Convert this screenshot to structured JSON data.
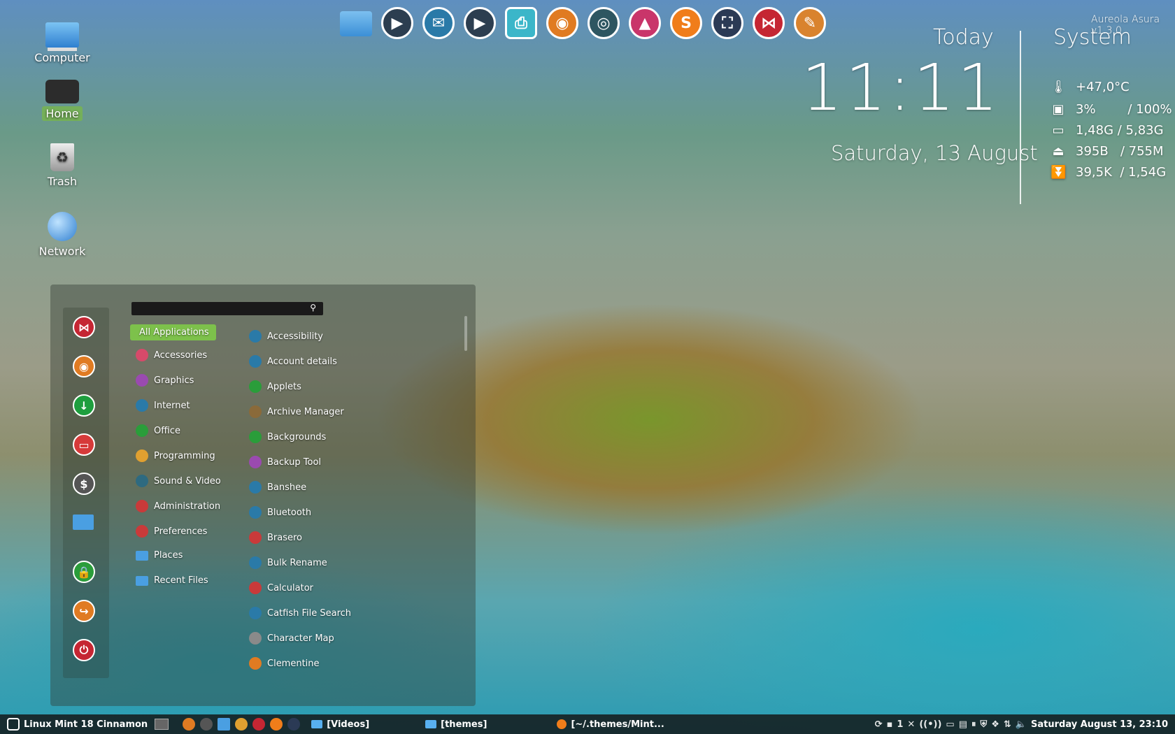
{
  "desktop": {
    "icons": [
      {
        "label": "Computer",
        "icon": "computer-icon"
      },
      {
        "label": "Home",
        "icon": "home-folder-icon"
      },
      {
        "label": "Trash",
        "icon": "trash-icon"
      },
      {
        "label": "Network",
        "icon": "network-icon"
      }
    ]
  },
  "dock": {
    "items": [
      {
        "icon": "folder-icon",
        "color": "#4a9fe2"
      },
      {
        "icon": "video-player-icon",
        "color": "#2c3e50"
      },
      {
        "icon": "thunderbird-icon",
        "color": "#2a7aa8"
      },
      {
        "icon": "video-player-icon",
        "color": "#2c3e50"
      },
      {
        "icon": "printer-icon",
        "color": "#3bb6c9"
      },
      {
        "icon": "firefox-icon",
        "color": "#e07b22"
      },
      {
        "icon": "eye-of-gnome-icon",
        "color": "#2e5661"
      },
      {
        "icon": "inkscape-icon",
        "color": "#c9356a"
      },
      {
        "icon": "sublime-text-icon",
        "color": "#f07d1a"
      },
      {
        "icon": "screenshot-icon",
        "color": "#2b3a55"
      },
      {
        "icon": "bow-tie-app-icon",
        "color": "#c52633"
      },
      {
        "icon": "gimp-icon",
        "color": "#d9832e"
      }
    ]
  },
  "conky": {
    "version": "Aureola Asura v1.3.0",
    "today_title": "Today",
    "time": "11:11",
    "date": "Saturday, 13 August",
    "system_title": "System",
    "stats": [
      {
        "icon": "thermometer-icon",
        "text": "+47,0°C"
      },
      {
        "icon": "cpu-icon",
        "text": "3%        / 100%"
      },
      {
        "icon": "memory-icon",
        "text": "1,48G / 5,83G"
      },
      {
        "icon": "upload-icon",
        "text": "395B   / 755M"
      },
      {
        "icon": "download-icon",
        "text": "39,5K  / 1,54G"
      }
    ]
  },
  "menu": {
    "search_placeholder": "",
    "favorites": [
      {
        "icon": "bow-tie-app-icon",
        "color": "#c52633"
      },
      {
        "icon": "firefox-icon",
        "color": "#e07b22"
      },
      {
        "icon": "download-icon",
        "color": "#1e9e3e"
      },
      {
        "icon": "media-icon",
        "color": "#d63a3a"
      },
      {
        "icon": "terminal-icon",
        "color": "#555555"
      },
      {
        "icon": "folder-icon",
        "color": "#4a9fe2"
      },
      {
        "icon": "lock-icon",
        "color": "#2a9d3a"
      },
      {
        "icon": "logout-icon",
        "color": "#e07b22"
      },
      {
        "icon": "power-icon",
        "color": "#c52633"
      }
    ],
    "categories": [
      {
        "label": "All Applications",
        "color": "#7dc14b"
      },
      {
        "label": "Accessories",
        "color": "#d64a6a"
      },
      {
        "label": "Graphics",
        "color": "#9a4ab0"
      },
      {
        "label": "Internet",
        "color": "#2a7aa8"
      },
      {
        "label": "Office",
        "color": "#2a9d3a"
      },
      {
        "label": "Programming",
        "color": "#e0a030"
      },
      {
        "label": "Sound & Video",
        "color": "#2e6a80"
      },
      {
        "label": "Administration",
        "color": "#c93a3a"
      },
      {
        "label": "Preferences",
        "color": "#c93a3a"
      },
      {
        "label": "Places",
        "color": "#4a9fe2"
      },
      {
        "label": "Recent Files",
        "color": "#4a9fe2"
      }
    ],
    "applications": [
      {
        "label": "Accessibility",
        "color": "#2a7aa8"
      },
      {
        "label": "Account details",
        "color": "#2a7aa8"
      },
      {
        "label": "Applets",
        "color": "#2a9d3a"
      },
      {
        "label": "Archive Manager",
        "color": "#8a6a3a"
      },
      {
        "label": "Backgrounds",
        "color": "#2a9d3a"
      },
      {
        "label": "Backup Tool",
        "color": "#9a4ab0"
      },
      {
        "label": "Banshee",
        "color": "#2a7aa8"
      },
      {
        "label": "Bluetooth",
        "color": "#2a7aa8"
      },
      {
        "label": "Brasero",
        "color": "#c93a3a"
      },
      {
        "label": "Bulk Rename",
        "color": "#2a7aa8"
      },
      {
        "label": "Calculator",
        "color": "#c93a3a"
      },
      {
        "label": "Catfish File Search",
        "color": "#2a7aa8"
      },
      {
        "label": "Character Map",
        "color": "#8a8a8a"
      },
      {
        "label": "Clementine",
        "color": "#e07b22"
      }
    ]
  },
  "panel": {
    "menu_label": "Linux Mint 18 Cinnamon",
    "launchers": [
      {
        "icon": "show-desktop-icon",
        "color": "#666666"
      },
      {
        "icon": "firefox-icon",
        "color": "#e07b22"
      },
      {
        "icon": "terminal-icon",
        "color": "#555555"
      },
      {
        "icon": "folder-icon",
        "color": "#4a9fe2"
      },
      {
        "icon": "disk-icon",
        "color": "#e0a030"
      },
      {
        "icon": "bow-tie-app-icon",
        "color": "#c52633"
      },
      {
        "icon": "sublime-text-icon",
        "color": "#f07d1a"
      },
      {
        "icon": "screenshot-icon",
        "color": "#2b3a55"
      }
    ],
    "windows": [
      {
        "label": "[Videos]",
        "icon": "folder-icon"
      },
      {
        "label": "[themes]",
        "icon": "folder-icon"
      },
      {
        "label": "[~/.themes/Mint...",
        "icon": "sublime-text-icon"
      }
    ],
    "tray_count": "1",
    "clock": "Saturday August 13, 23:10"
  }
}
